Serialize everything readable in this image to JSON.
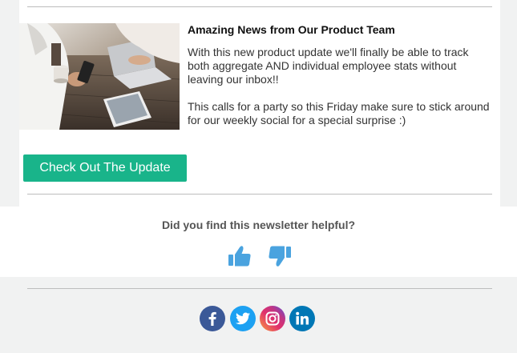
{
  "article": {
    "title": "Amazing News from Our Product Team",
    "paragraph1": "With this new product update we'll finally be able to track both aggregate AND individual employee stats without leaving our inbox!!",
    "paragraph2": "This calls for a party so this Friday make sure to stick around for our weekly social for a special surprise :)",
    "image_icon": "laptop-coffee-photo"
  },
  "cta": {
    "label": "Check Out The Update",
    "color": "#19b48a"
  },
  "feedback": {
    "question": "Did you find this newsletter helpful?",
    "thumbs_up_icon": "thumbs-up-icon",
    "thumbs_down_icon": "thumbs-down-icon",
    "icon_color": "#4aa3df"
  },
  "social": [
    {
      "name": "facebook",
      "icon": "facebook-icon",
      "color": "#3b5998"
    },
    {
      "name": "twitter",
      "icon": "twitter-icon",
      "color": "#1da1f2"
    },
    {
      "name": "instagram",
      "icon": "instagram-icon",
      "color": "#c13584"
    },
    {
      "name": "linkedin",
      "icon": "linkedin-icon",
      "color": "#0077b5"
    }
  ]
}
